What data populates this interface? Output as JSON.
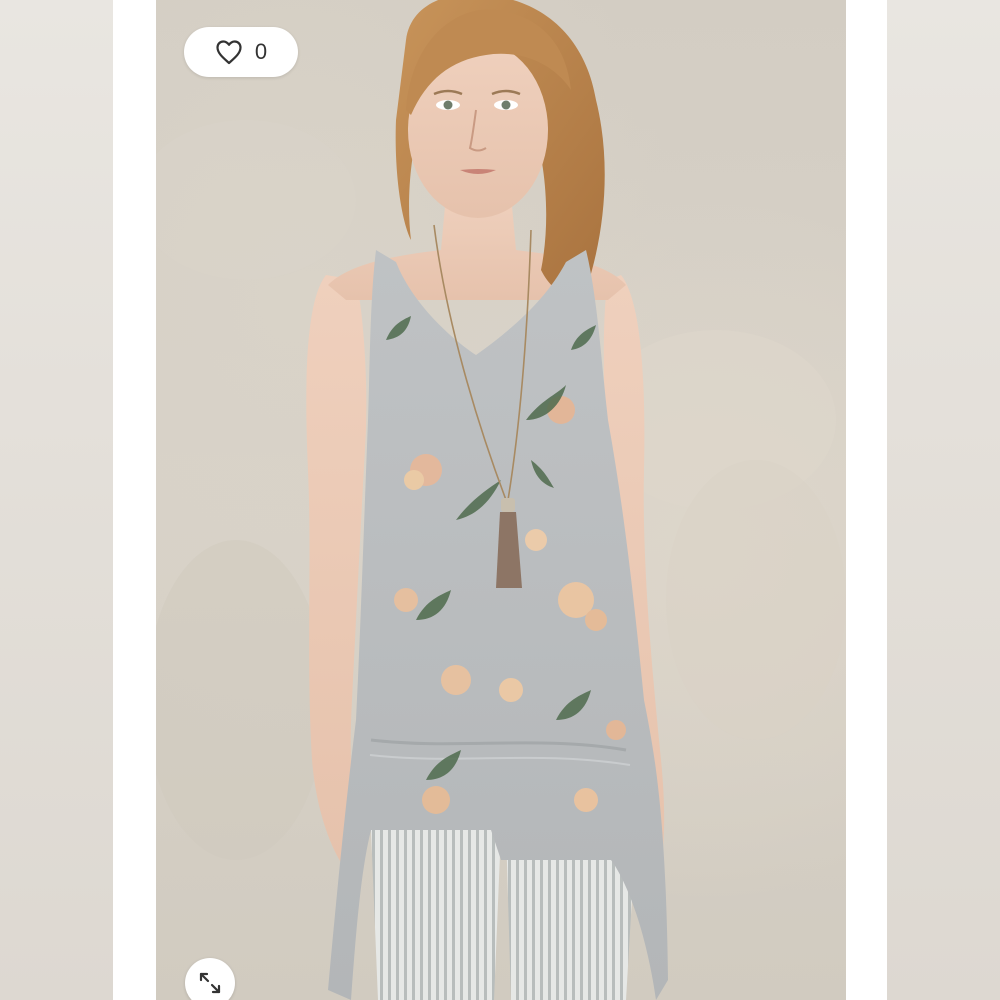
{
  "viewer": {
    "like": {
      "icon": "heart-outline-icon",
      "count": "0"
    },
    "expand": {
      "icon": "expand-arrows-icon"
    },
    "photo": {
      "subject": "product-photo"
    }
  },
  "colors": {
    "background": "#ffffff",
    "side_panel": "#e4e0da",
    "wall": "#d5cfc5",
    "garment": "#b9bcbf",
    "icon": "#333333"
  }
}
